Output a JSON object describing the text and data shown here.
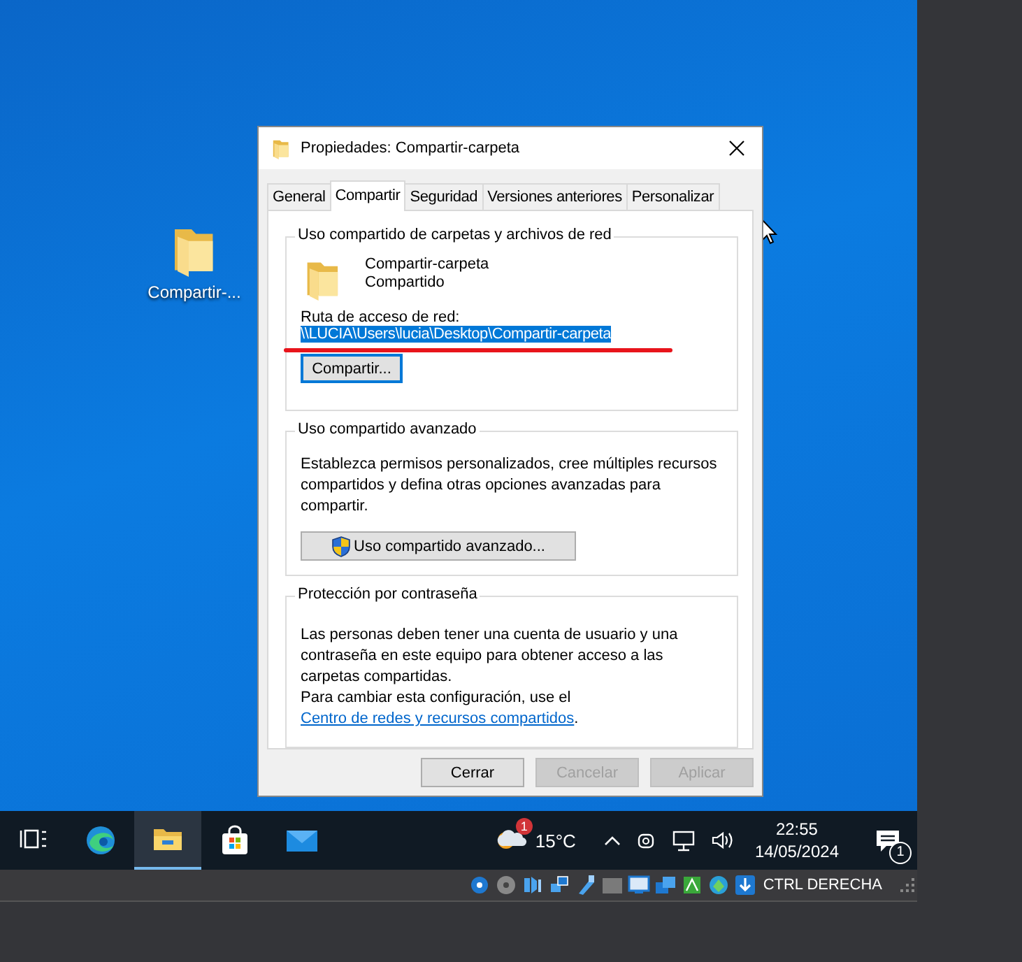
{
  "desktop_icons": [
    {
      "label": "Compartir-...",
      "selected": false
    }
  ],
  "dialog": {
    "title": "Propiedades: Compartir-carpeta",
    "tabs": [
      {
        "label": "General",
        "selected": false
      },
      {
        "label": "Compartir",
        "selected": true
      },
      {
        "label": "Seguridad",
        "selected": false
      },
      {
        "label": "Versiones anteriores",
        "selected": false
      },
      {
        "label": "Personalizar",
        "selected": false
      }
    ],
    "sharing": {
      "heading": "Uso compartido de carpetas y archivos de red",
      "folder_name": "Compartir-carpeta",
      "folder_state": "Compartido",
      "path_label": "Ruta de acceso de red:",
      "path": "\\\\LUCIA\\Users\\lucia\\Desktop\\Compartir-carpeta",
      "path_selected": true,
      "button": "Compartir..."
    },
    "advanced": {
      "heading": "Uso compartido avanzado",
      "text": "Establezca permisos personalizados, cree múltiples recursos compartidos y defina otras opciones avanzadas para compartir.",
      "button": "Uso compartido avanzado..."
    },
    "password": {
      "heading": "Protección por contraseña",
      "text": "Las personas deben tener una cuenta de usuario y una contraseña en este equipo para obtener acceso a las carpetas compartidas.",
      "note": "Para cambiar esta configuración, use el",
      "link": "Centro de redes y recursos compartidos",
      "note_end": "."
    },
    "buttons": [
      {
        "label": "Cerrar",
        "disabled": false
      },
      {
        "label": "Cancelar",
        "disabled": true
      },
      {
        "label": "Aplicar",
        "disabled": true
      }
    ]
  },
  "taskbar": {
    "apps": [
      {
        "kind": "taskview",
        "selected": false
      },
      {
        "kind": "edge",
        "selected": false
      },
      {
        "kind": "explorer",
        "selected": true
      },
      {
        "kind": "store",
        "selected": false
      },
      {
        "kind": "mail",
        "selected": false
      }
    ],
    "weather_badge": "1",
    "temperature": "15°C",
    "time": "22:55",
    "date": "14/05/2024",
    "notification_count": "1"
  },
  "vm_status": {
    "host_key": "CTRL DERECHA"
  }
}
